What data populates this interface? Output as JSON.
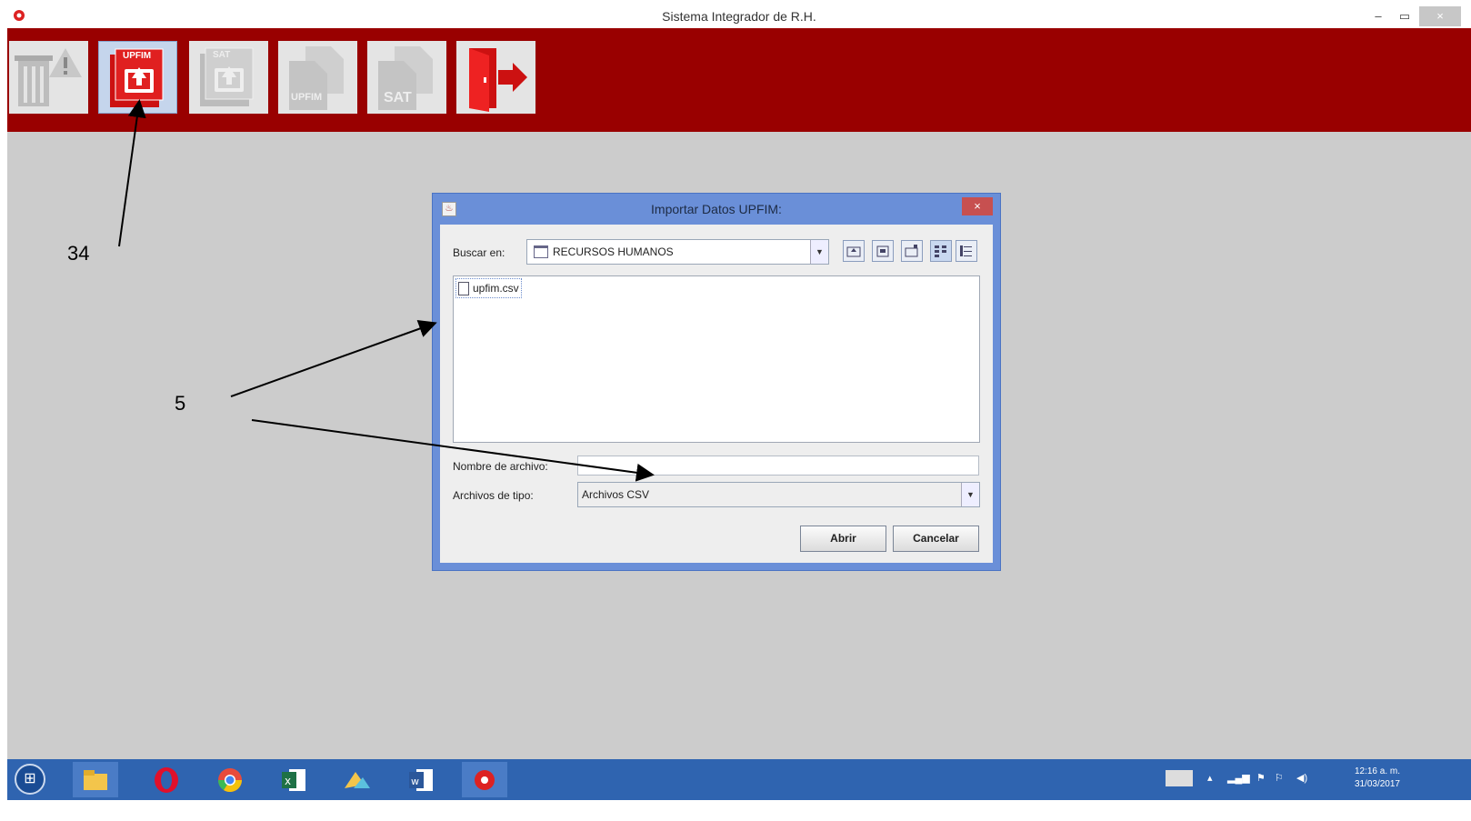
{
  "window": {
    "title": "Sistema Integrador de R.H.",
    "min_label": "–",
    "max_label": "▭",
    "close_label": "×"
  },
  "toolbar": {
    "buttons": [
      {
        "name": "delete-warning",
        "caption": ""
      },
      {
        "name": "import-upfim",
        "caption": "UPFIM"
      },
      {
        "name": "import-sat",
        "caption": "SAT"
      },
      {
        "name": "export-upfim",
        "caption": "UPFIM"
      },
      {
        "name": "export-sat",
        "caption": "SAT"
      },
      {
        "name": "exit",
        "caption": ""
      }
    ]
  },
  "annotations": {
    "label_34": "34",
    "label_5": "5"
  },
  "dialog": {
    "title": "Importar Datos UPFIM:",
    "close_label": "×",
    "look_in_label": "Buscar en:",
    "look_in_value": "RECURSOS HUMANOS",
    "files": [
      {
        "name": "upfim.csv"
      }
    ],
    "filename_label": "Nombre de archivo:",
    "filename_value": "",
    "filetype_label": "Archivos de tipo:",
    "filetype_value": "Archivos CSV",
    "open_label": "Abrir",
    "cancel_label": "Cancelar"
  },
  "taskbar": {
    "clock_time": "12:16 a. m.",
    "clock_date": "31/03/2017"
  },
  "colors": {
    "toolbar_bg": "#990000",
    "dialog_frame": "#6a8fd8",
    "taskbar_bg": "#2f64b0"
  }
}
